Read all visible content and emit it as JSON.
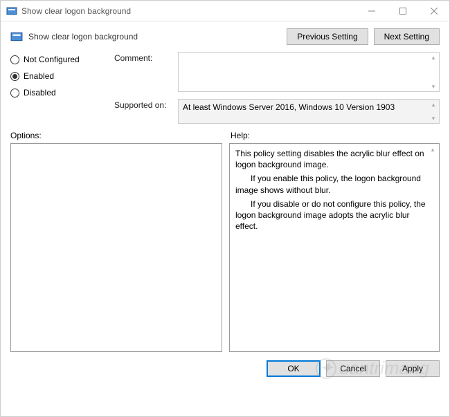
{
  "window": {
    "title": "Show clear logon background"
  },
  "header": {
    "title": "Show clear logon background",
    "prev_btn": "Previous Setting",
    "next_btn": "Next Setting"
  },
  "radios": {
    "not_configured": "Not Configured",
    "enabled": "Enabled",
    "disabled": "Disabled",
    "selected": "enabled"
  },
  "fields": {
    "comment_label": "Comment:",
    "comment_value": "",
    "supported_label": "Supported on:",
    "supported_value": "At least Windows Server 2016, Windows 10 Version 1903"
  },
  "sections": {
    "options_label": "Options:",
    "help_label": "Help:"
  },
  "help": {
    "p1": "This policy setting disables the acrylic blur effect on logon background image.",
    "p2": "If you enable this policy, the logon background image shows without blur.",
    "p3": "If you disable or do not configure this policy, the logon background image adopts the acrylic blur effect."
  },
  "footer": {
    "ok": "OK",
    "cancel": "Cancel",
    "apply": "Apply"
  },
  "watermark": "uantrimang"
}
